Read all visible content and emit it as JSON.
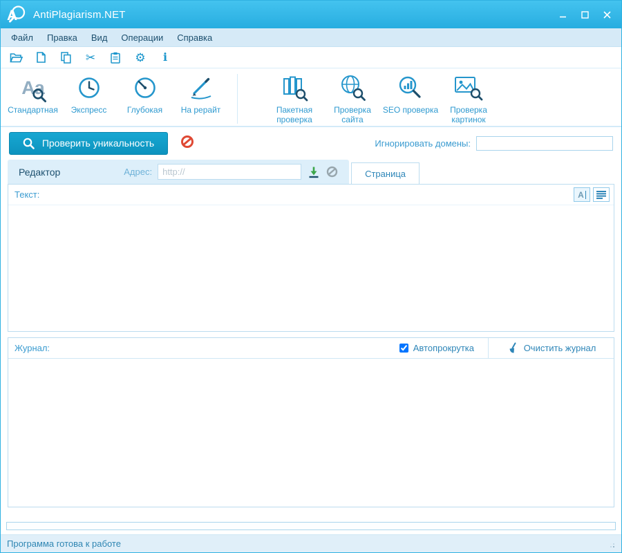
{
  "window": {
    "title": "AntiPlagiarism.NET",
    "logo_glyph": "A"
  },
  "menu": {
    "items": [
      {
        "label": "Файл"
      },
      {
        "label": "Правка"
      },
      {
        "label": "Вид"
      },
      {
        "label": "Операции"
      },
      {
        "label": "Справка"
      }
    ]
  },
  "toolbar": {
    "cut_glyph": "✂",
    "settings_glyph": "⚙",
    "info_glyph": "i"
  },
  "ribbon": {
    "modes": [
      {
        "label": "Стандартная",
        "glyph": "Aa"
      },
      {
        "label": "Экспресс"
      },
      {
        "label": "Глубокая"
      },
      {
        "label": "На рерайт"
      }
    ],
    "tools": [
      {
        "label": "Пакетная проверка"
      },
      {
        "label": "Проверка сайта"
      },
      {
        "label": "SEO проверка"
      },
      {
        "label": "Проверка картинок"
      }
    ]
  },
  "actions": {
    "check_button": "Проверить уникальность",
    "ignore_domains_label": "Игнорировать домены:",
    "ignore_domains_value": ""
  },
  "tabs": {
    "editor_label": "Редактор",
    "page_label": "Страница",
    "address_label": "Адрес:",
    "address_placeholder": "http://",
    "address_value": ""
  },
  "editor": {
    "text_label": "Текст:",
    "a_button_glyph": "A",
    "content": ""
  },
  "log": {
    "label": "Журнал:",
    "autoscroll_label": "Автопрокрутка",
    "autoscroll_checked": "checked",
    "clear_button": "Очистить журнал",
    "content": ""
  },
  "status": {
    "message": "Программа готова к работе"
  },
  "colors": {
    "titlebar": "#2fb6e9",
    "accent": "#1b96cc",
    "icon_dark": "#1d4e6b",
    "panel_border": "#bcdcef",
    "check_button": "#0f9ac6",
    "stop_red": "#df4934",
    "download_green": "#3ba649"
  }
}
